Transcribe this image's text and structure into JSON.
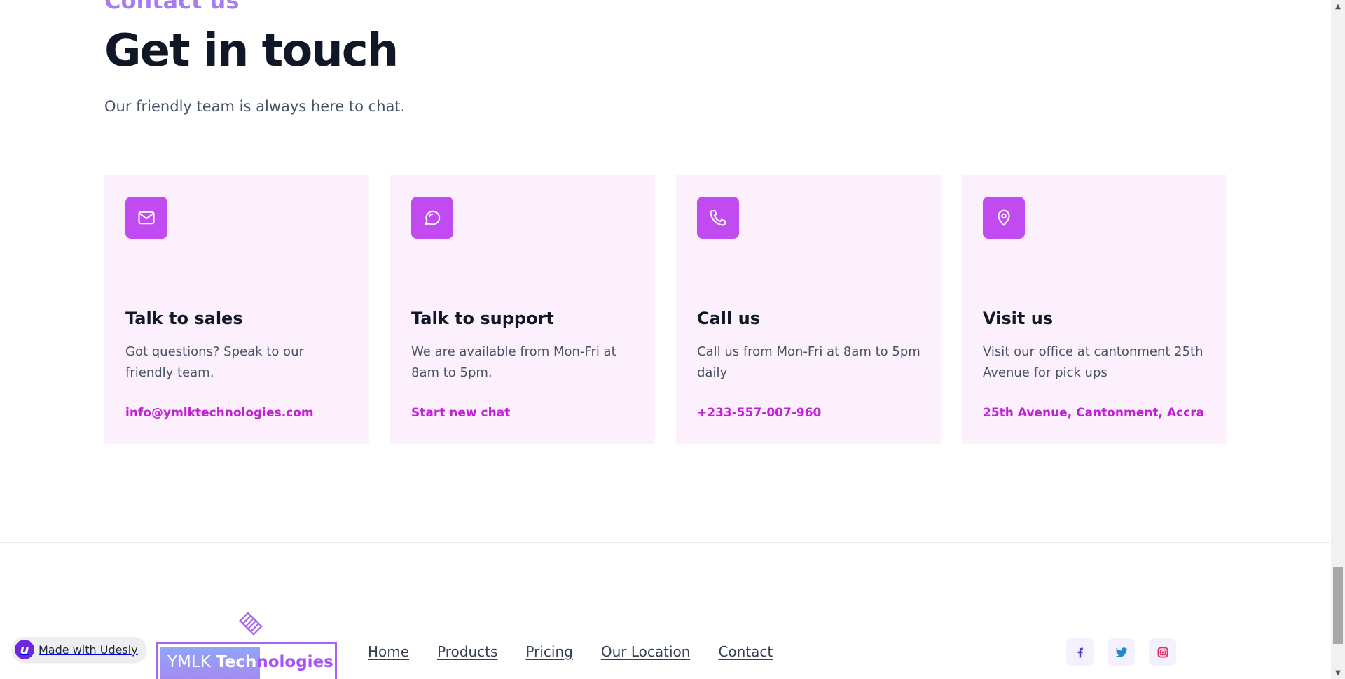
{
  "contact": {
    "eyebrow": "Contact us",
    "title": "Get in touch",
    "subtitle": "Our friendly team is always here to chat.",
    "cards": [
      {
        "icon": "mail-icon",
        "title": "Talk to sales",
        "text": "Got questions? Speak to our friendly team.",
        "link": "info@ymlktechnologies.com"
      },
      {
        "icon": "chat-bubble-icon",
        "title": "Talk to support",
        "text": "We are available from Mon-Fri at 8am to 5pm.",
        "link": "Start new chat"
      },
      {
        "icon": "phone-icon",
        "title": "Call us",
        "text": "Call us from Mon-Fri at 8am to 5pm daily",
        "link": "+233-557-007-960"
      },
      {
        "icon": "map-pin-icon",
        "title": "Visit us",
        "text": "Visit our office at cantonment 25th Avenue for pick ups",
        "link": "25th Avenue, Cantonment, Accra"
      }
    ]
  },
  "footer": {
    "logo": {
      "part1": "YMLK ",
      "part2": "Tech",
      "part3": "nologies"
    },
    "nav": [
      "Home",
      "Products",
      "Pricing",
      "Our Location",
      "Contact"
    ],
    "social": [
      "facebook-icon",
      "twitter-icon",
      "instagram-icon"
    ],
    "badge": "Made with Udesly"
  },
  "colors": {
    "accent": "#c14bf0",
    "link": "#c41fd8",
    "card_bg": "#fcf0fd",
    "heading": "#101828",
    "body_text": "#475467",
    "eyebrow": "#a77bf1"
  }
}
